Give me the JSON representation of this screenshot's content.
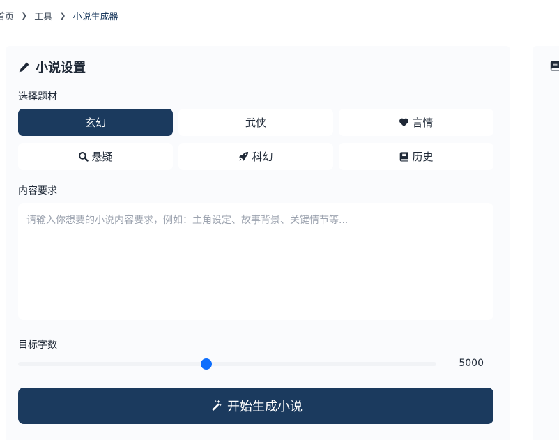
{
  "breadcrumb": {
    "items": [
      "首页",
      "工具",
      "小说生成器"
    ]
  },
  "settings": {
    "title": "小说设置",
    "title_icon": "pencil-icon",
    "genre_label": "选择题材",
    "genres": [
      {
        "label": "玄幻",
        "icon": "",
        "active": true
      },
      {
        "label": "武侠",
        "icon": "",
        "active": false
      },
      {
        "label": "言情",
        "icon": "heart-icon",
        "active": false
      },
      {
        "label": "悬疑",
        "icon": "search-icon",
        "active": false
      },
      {
        "label": "科幻",
        "icon": "rocket-icon",
        "active": false
      },
      {
        "label": "历史",
        "icon": "book-icon",
        "active": false
      }
    ],
    "content_label": "内容要求",
    "content_value": "",
    "content_placeholder": "请输入你想要的小说内容要求，例如：主角设定、故事背景、关键情节等...",
    "word_count_label": "目标字数",
    "word_count_value": "5000",
    "word_count_fraction": 0.45,
    "generate_label": "开始生成小说",
    "generate_icon": "magic-wand-icon"
  },
  "right_panel": {
    "icon": "book-icon"
  },
  "colors": {
    "primary": "#1b3a5e",
    "slider_thumb": "#0d6efd",
    "panel_bg": "#fafbfd"
  }
}
